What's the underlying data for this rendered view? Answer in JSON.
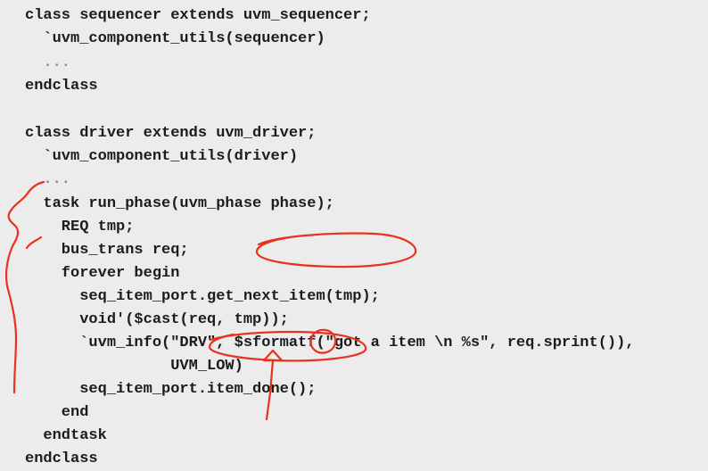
{
  "code_lines": [
    "class sequencer extends uvm_sequencer;",
    "  `uvm_component_utils(sequencer)",
    "  ...",
    "endclass",
    "",
    "class driver extends uvm_driver;",
    "  `uvm_component_utils(driver)",
    "  ...",
    "  task run_phase(uvm_phase phase);",
    "    REQ tmp;",
    "    bus_trans req;",
    "    forever begin",
    "      seq_item_port.get_next_item(tmp);",
    "      void'($cast(req, tmp));",
    "      `uvm_info(\"DRV\", $sformatf(\"got a item \\n %s\", req.sprint()),",
    "                UVM_LOW)",
    "      seq_item_port.item_done();",
    "    end",
    "  endtask",
    "endclass"
  ],
  "colors": {
    "background": "#ececec",
    "code_text": "#1c1c1c",
    "ellipsis_text": "#8c8c8c",
    "annotation": "#e8321e"
  }
}
